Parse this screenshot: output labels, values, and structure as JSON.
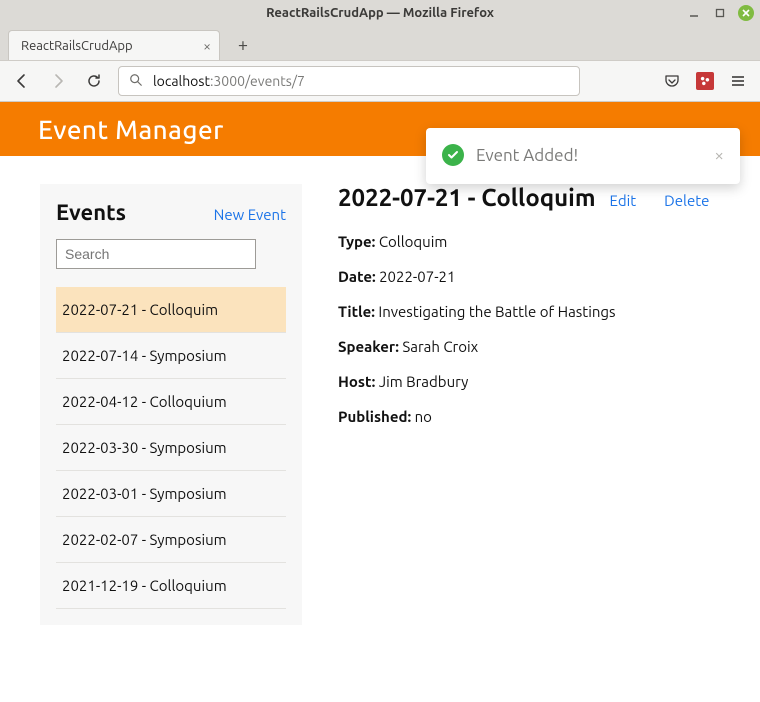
{
  "browser": {
    "window_title": "ReactRailsCrudApp — Mozilla Firefox",
    "tab_title": "ReactRailsCrudApp",
    "url_host": "localhost",
    "url_path": ":3000/events/7"
  },
  "app": {
    "title": "Event Manager"
  },
  "toast": {
    "message": "Event Added!"
  },
  "sidebar": {
    "title": "Events",
    "new_event_label": "New Event",
    "search_placeholder": "Search",
    "items": [
      {
        "label": "2022-07-21 - Colloquim",
        "selected": true
      },
      {
        "label": "2022-07-14 - Symposium",
        "selected": false
      },
      {
        "label": "2022-04-12 - Colloquium",
        "selected": false
      },
      {
        "label": "2022-03-30 - Symposium",
        "selected": false
      },
      {
        "label": "2022-03-01 - Symposium",
        "selected": false
      },
      {
        "label": "2022-02-07 - Symposium",
        "selected": false
      },
      {
        "label": "2021-12-19 - Colloquium",
        "selected": false
      }
    ]
  },
  "detail": {
    "heading": "2022-07-21 - Colloquim",
    "edit_label": "Edit",
    "delete_label": "Delete",
    "type_label": "Type:",
    "type_value": "Colloquim",
    "date_label": "Date:",
    "date_value": "2022-07-21",
    "title_label": "Title:",
    "title_value": "Investigating the Battle of Hastings",
    "speaker_label": "Speaker:",
    "speaker_value": "Sarah Croix",
    "host_label": "Host:",
    "host_value": "Jim Bradbury",
    "published_label": "Published:",
    "published_value": "no"
  }
}
